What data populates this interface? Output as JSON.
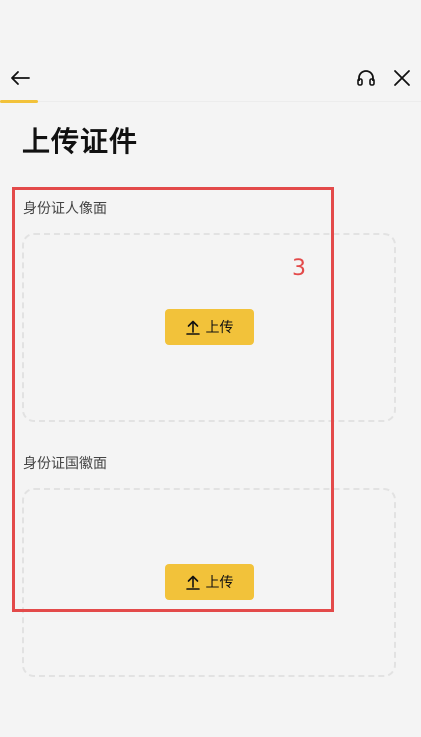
{
  "header": {
    "back_icon": "arrow-left-icon",
    "service_icon": "headset-icon",
    "close_icon": "close-icon",
    "accent_color": "#f2c23a"
  },
  "page": {
    "title": "上传证件"
  },
  "sections": [
    {
      "label": "身份证人像面",
      "button_label": "上传",
      "button_icon": "upload-icon"
    },
    {
      "label": "身份证国徽面",
      "button_label": "上传",
      "button_icon": "upload-icon"
    }
  ],
  "annotation": {
    "number": "3",
    "color": "#e34a4a"
  }
}
